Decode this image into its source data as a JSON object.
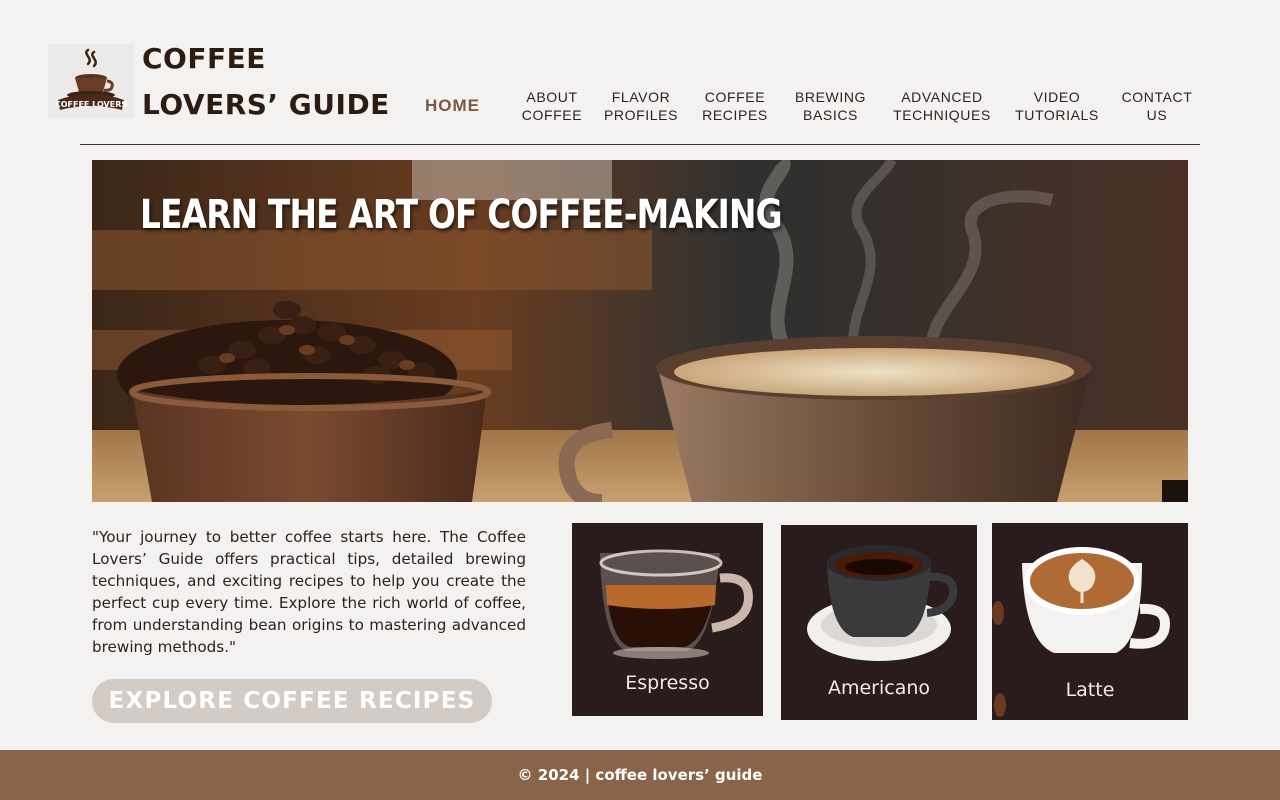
{
  "header": {
    "logo_text": "COFFEE LOVERS",
    "site_title": "COFFEE LOVERS’ GUIDE"
  },
  "nav": {
    "items": [
      {
        "label": "HOME",
        "active": true
      },
      {
        "label": "ABOUT\nCOFFEE",
        "active": false
      },
      {
        "label": "FLAVOR\nPROFILES",
        "active": false
      },
      {
        "label": "COFFEE\nRECIPES",
        "active": false
      },
      {
        "label": "BREWING\nBASICS",
        "active": false
      },
      {
        "label": "ADVANCED\nTECHNIQUES",
        "active": false
      },
      {
        "label": "VIDEO\nTUTORIALS",
        "active": false
      },
      {
        "label": "CONTACT\nUS",
        "active": false
      }
    ]
  },
  "hero": {
    "title": "LEARN THE ART OF COFFEE-MAKING"
  },
  "intro": {
    "text": "\"Your journey to better coffee starts here. The Coffee Lovers’ Guide offers practical tips, detailed brewing techniques, and exciting recipes to help you create the perfect cup every time. Explore the rich world of coffee, from understanding bean origins to mastering advanced brewing methods.\"",
    "cta_label": "EXPLORE COFFEE RECIPES"
  },
  "cards": [
    {
      "label": "Espresso"
    },
    {
      "label": "Americano"
    },
    {
      "label": "Latte"
    }
  ],
  "footer": {
    "text": "© 2024 | coffee lovers’ guide"
  },
  "colors": {
    "background": "#f4f2f0",
    "nav_active": "#7b5a45",
    "card_background": "#2a1b1c",
    "button_background": "#d3cbc6",
    "footer_background": "#8a6448"
  }
}
